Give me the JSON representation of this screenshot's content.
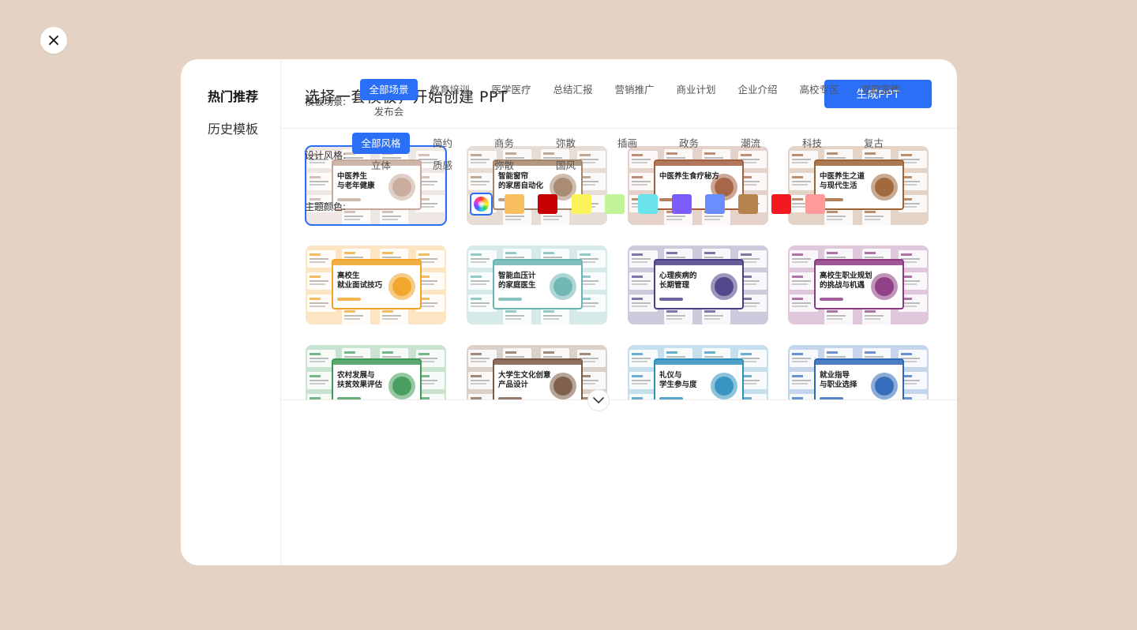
{
  "sidebar": {
    "items": [
      {
        "label": "热门推荐"
      },
      {
        "label": "历史模板"
      }
    ]
  },
  "header": {
    "title": "选择一套模板，开始创建 PPT",
    "generate_label": "生成PPT"
  },
  "templates": [
    {
      "title": "中医养生\n与老年健康",
      "theme": "#c6a99a"
    },
    {
      "title": "智能窗帘\n的家居自动化",
      "theme": "#a5866a"
    },
    {
      "title": "中医养生食疗秘方",
      "theme": "#a35f3f"
    },
    {
      "title": "中医养生之道\n与现代生活",
      "theme": "#9c6335"
    },
    {
      "title": "高校生\n就业面试技巧",
      "theme": "#f0a324"
    },
    {
      "title": "智能血压计\n的家庭医生",
      "theme": "#6ab5b1"
    },
    {
      "title": "心理疾病的\n长期管理",
      "theme": "#4a3f86"
    },
    {
      "title": "高校生职业规划\n的挑战与机遇",
      "theme": "#8c3a82"
    },
    {
      "title": "农村发展与\n扶贫效果评估",
      "theme": "#3f9a5a"
    },
    {
      "title": "大学生文化创意\n产品设计",
      "theme": "#7a5a46"
    },
    {
      "title": "礼仪与\n学生参与度",
      "theme": "#2f8fbc"
    },
    {
      "title": "就业指导\n与职业选择",
      "theme": "#2e67b8"
    }
  ],
  "filters": {
    "scene_label": "模板场景:",
    "scenes": [
      "全部场景",
      "教育培训",
      "医学医疗",
      "总结汇报",
      "营销推广",
      "商业计划",
      "企业介绍",
      "高校专区",
      "党政宣传",
      "发布会"
    ],
    "style_label": "设计风格:",
    "styles": [
      "全部风格",
      "简约",
      "商务",
      "弥散",
      "插画",
      "政务",
      "潮流",
      "科技",
      "复古",
      "立体",
      "质感",
      "弥散",
      "国风"
    ],
    "color_label": "主题颜色:",
    "colors": [
      "#f9bf5e",
      "#c60000",
      "#fbf35a",
      "#c2f59a",
      "#6ae3ed",
      "#7a5cff",
      "#6a8dff",
      "#b5834e",
      "#f3191e",
      "#fd9a9a"
    ]
  }
}
